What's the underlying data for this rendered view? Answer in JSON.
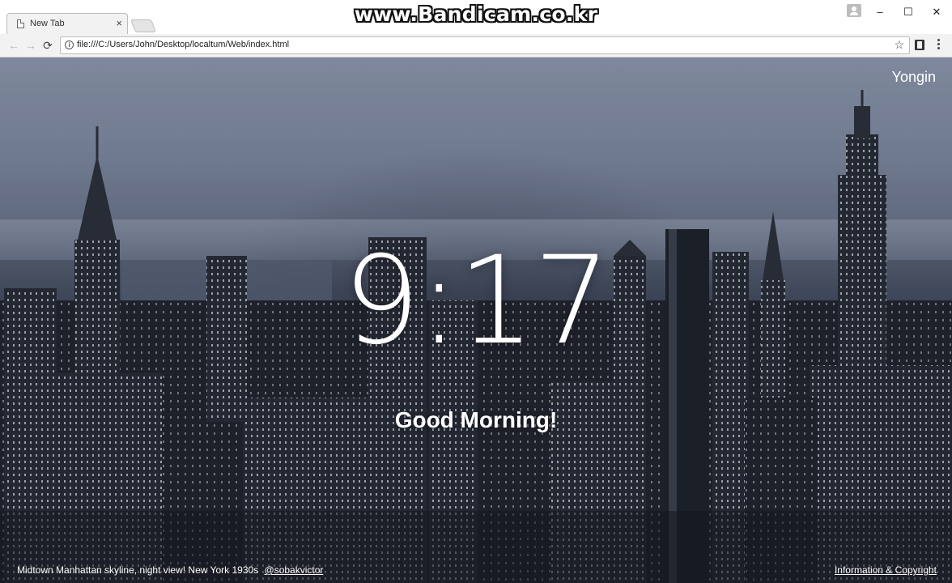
{
  "browser": {
    "tab_title": "New Tab",
    "tab_close": "×",
    "url": "file:///C:/Users/John/Desktop/localtum/Web/index.html",
    "back": "←",
    "forward": "→",
    "reload": "⟳",
    "bookmark": "☆",
    "window_controls": {
      "minimize": "–",
      "maximize": "☐",
      "close": "✕"
    }
  },
  "watermark": "www.Bandicam.co.kr",
  "page": {
    "location": "Yongin",
    "time": "9:17",
    "greeting": "Good Morning!",
    "photo_caption": "Midtown Manhattan skyline, night view! New York 1930s",
    "photo_credit": "@sobakvictor",
    "footer_link": "Information & Copyright"
  }
}
